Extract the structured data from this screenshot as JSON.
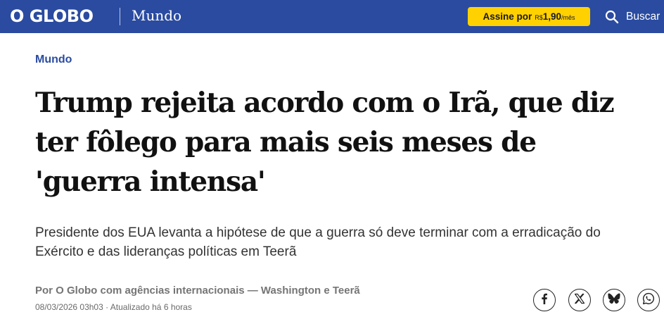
{
  "header": {
    "logo": "O GLOBO",
    "section": "Mundo",
    "subscribe": {
      "label": "Assine por",
      "currency": "R$",
      "price": "1,90",
      "period": "/mês"
    },
    "search_label": "Buscar"
  },
  "article": {
    "kicker": "Mundo",
    "headline": "Trump rejeita acordo com o Irã, que diz ter fôlego para mais seis meses de 'guerra intensa'",
    "standfirst": "Presidente dos EUA levanta a hipótese de que a guerra só deve terminar com a erradicação do Exército e das lideranças políticas em Teerã",
    "byline": "Por O Globo com agências internacionais — Washington e Teerã",
    "dateline": "08/03/2026 03h03 · Atualizado há 6 horas"
  },
  "share": {
    "icons": [
      "facebook-icon",
      "x-icon",
      "bluesky-icon",
      "whatsapp-icon"
    ]
  },
  "colors": {
    "brand_blue": "#2a4ba0",
    "subscribe_yellow": "#ffd100",
    "headline": "#111111"
  }
}
